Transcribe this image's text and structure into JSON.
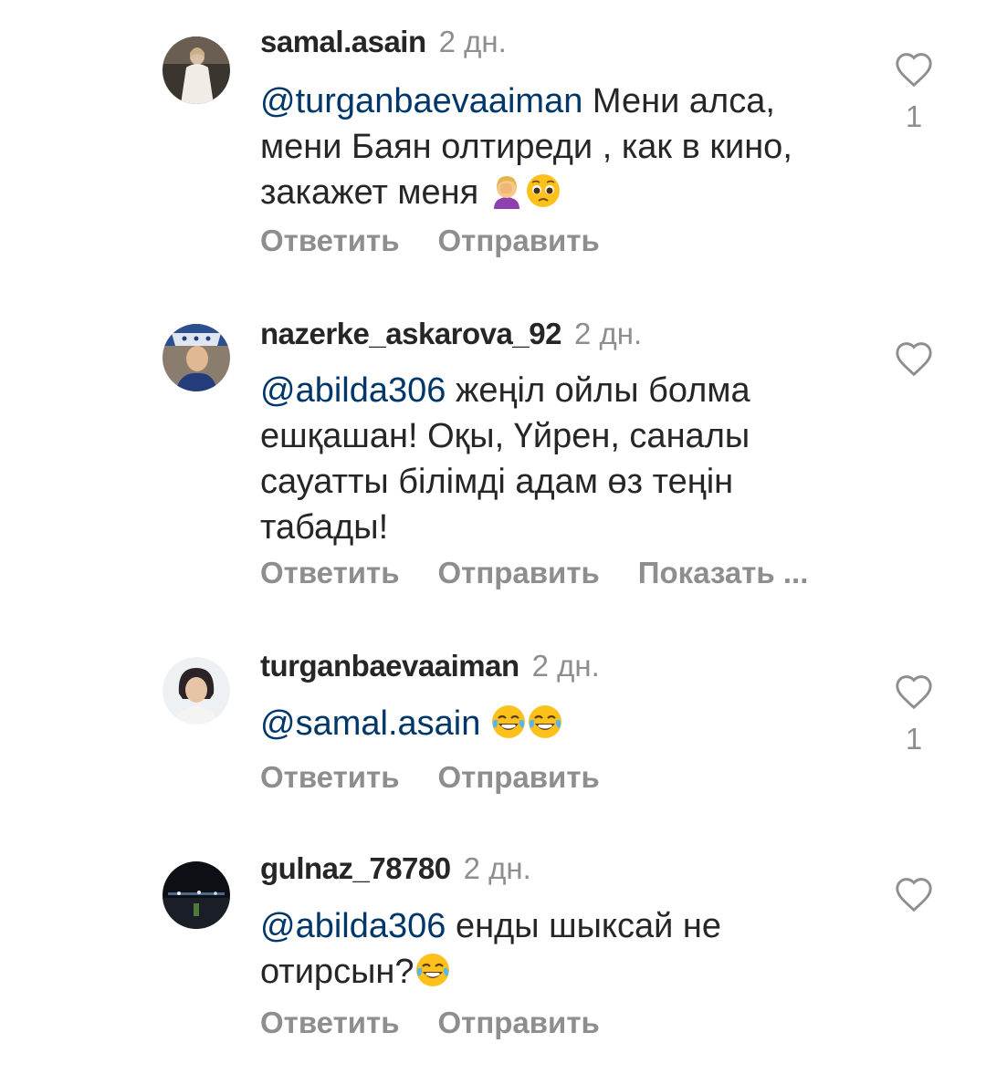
{
  "comments": [
    {
      "username": "samal.asain",
      "time": "2 дн.",
      "mention": "@turganbaevaaiman",
      "text": " Мени алса, мени Баян олтиреди , как в кино, закажет меня ",
      "emojis": [
        "woman-facepalming-emoji",
        "pleading-face-emoji"
      ],
      "actions": [
        "Ответить",
        "Отправить"
      ],
      "likes": "1"
    },
    {
      "username": "nazerke_askarova_92",
      "time": "2 дн.",
      "mention": "@abilda306",
      "text": " жеңіл ойлы болма ешқашан! Оқы, Үйрен, саналы сауатты білімді адам өз теңін табады!",
      "emojis": [],
      "actions": [
        "Ответить",
        "Отправить",
        "Показать ..."
      ],
      "likes": ""
    },
    {
      "username": "turganbaevaaiman",
      "time": "2 дн.",
      "mention": "@samal.asain",
      "text": " ",
      "emojis": [
        "face-with-tears-of-joy-emoji",
        "face-with-tears-of-joy-emoji"
      ],
      "actions": [
        "Ответить",
        "Отправить"
      ],
      "likes": "1"
    },
    {
      "username": "gulnaz_78780",
      "time": "2 дн.",
      "mention": "@abilda306",
      "text": " енды шыксай не отирсын?",
      "emojis": [
        "face-with-tears-of-joy-emoji"
      ],
      "actions": [
        "Ответить",
        "Отправить"
      ],
      "likes": ""
    }
  ],
  "colors": {
    "text": "#262626",
    "secondary": "#8e8e8e",
    "mention": "#00376b"
  },
  "icons": {
    "like": "heart-outline-icon"
  }
}
